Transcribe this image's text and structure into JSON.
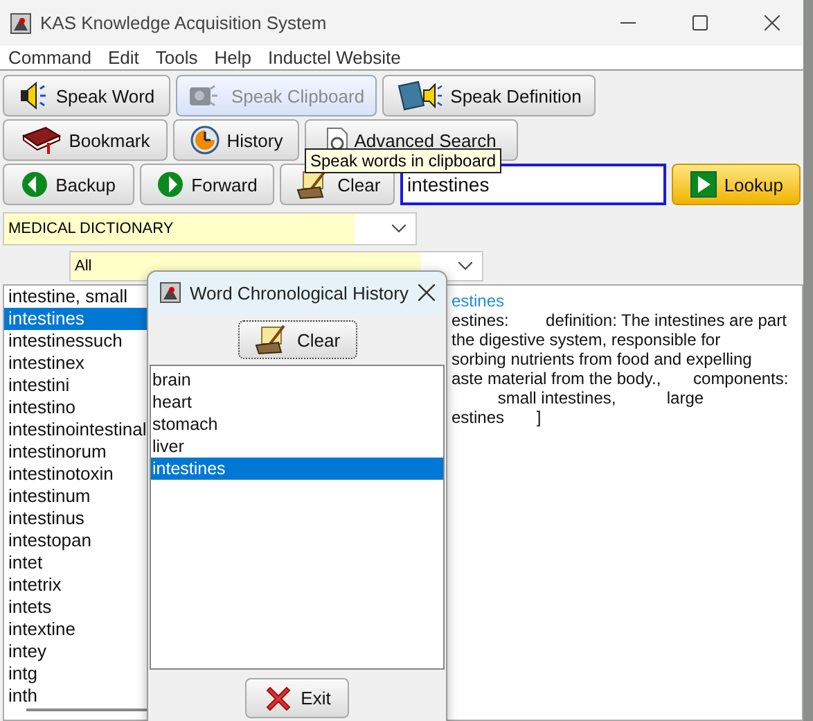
{
  "window": {
    "title": "KAS Knowledge Acquisition System"
  },
  "menu": [
    "Command",
    "Edit",
    "Tools",
    "Help",
    "Inductel Website"
  ],
  "button_rows": [
    [
      {
        "label": "Speak Word",
        "disabled": false
      },
      {
        "label": "Speak Clipboard",
        "disabled": true
      },
      {
        "label": "Speak Definition",
        "disabled": false
      }
    ],
    [
      {
        "label": "Bookmark",
        "disabled": false
      },
      {
        "label": "History",
        "disabled": false
      },
      {
        "label": "Advanced Search",
        "disabled": false
      }
    ]
  ],
  "tooltip": "Speak words in clipboard",
  "nav_buttons": [
    {
      "label": "Backup"
    },
    {
      "label": "Forward"
    },
    {
      "label": "Clear"
    }
  ],
  "search": {
    "value": "intestines",
    "focused": true
  },
  "lookup_button": {
    "label": "Lookup",
    "default": true
  },
  "dictionary_dropdown": {
    "value": "MEDICAL DICTIONARY"
  },
  "category_dropdown": {
    "value": "All"
  },
  "word_list": [
    {
      "text": "intestine, small",
      "selected": false
    },
    {
      "text": "intestines",
      "selected": true
    },
    {
      "text": "intestinessuch",
      "selected": false
    },
    {
      "text": "intestinex",
      "selected": false
    },
    {
      "text": "intestini",
      "selected": false
    },
    {
      "text": "intestino",
      "selected": false
    },
    {
      "text": "intestinointestinal",
      "selected": false
    },
    {
      "text": "intestinorum",
      "selected": false
    },
    {
      "text": "intestinotoxin",
      "selected": false
    },
    {
      "text": "intestinum",
      "selected": false
    },
    {
      "text": "intestinus",
      "selected": false
    },
    {
      "text": "intestopan",
      "selected": false
    },
    {
      "text": "intet",
      "selected": false
    },
    {
      "text": "intetrix",
      "selected": false
    },
    {
      "text": "intets",
      "selected": false
    },
    {
      "text": "intextine",
      "selected": false
    },
    {
      "text": "intey",
      "selected": false
    },
    {
      "text": "intg",
      "selected": false
    },
    {
      "text": "inth",
      "selected": false
    }
  ],
  "definition": {
    "heading": "estines",
    "lines": [
      "estines:        definition: The intestines are part",
      "the digestive system, responsible for",
      "sorbing nutrients from food and expelling",
      "aste material from the body.,       components:",
      "          small intestines,           large",
      "estines       ]"
    ]
  },
  "history_dialog": {
    "title": "Word Chronological History",
    "clear_button": "Clear",
    "items": [
      {
        "text": "brain",
        "selected": false
      },
      {
        "text": "heart",
        "selected": false
      },
      {
        "text": "stomach",
        "selected": false
      },
      {
        "text": "liver",
        "selected": false
      },
      {
        "text": "intestines",
        "selected": true
      }
    ],
    "exit_button": "Exit"
  }
}
